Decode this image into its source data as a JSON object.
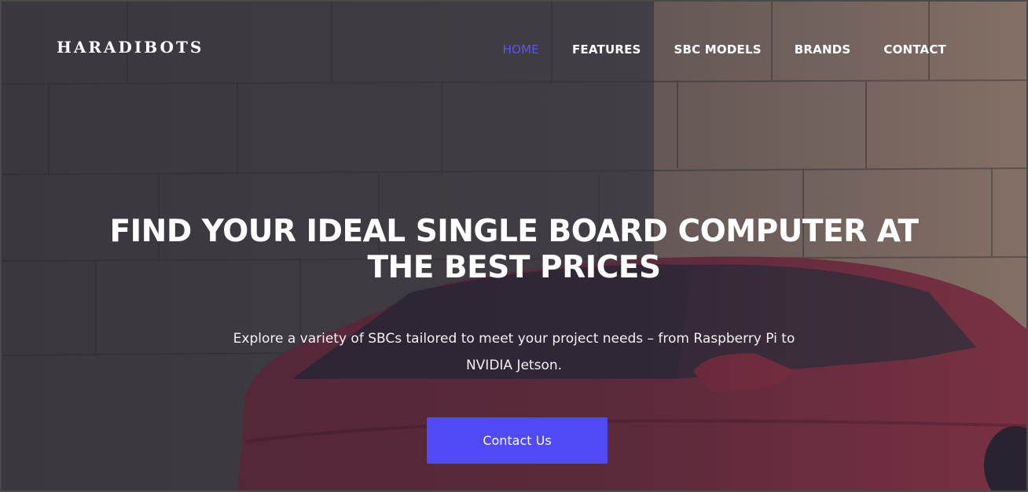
{
  "brand": {
    "logo": "HARADIBOTS"
  },
  "nav": {
    "items": [
      {
        "label": "HOME",
        "active": true
      },
      {
        "label": "FEATURES",
        "active": false
      },
      {
        "label": "SBC MODELS",
        "active": false
      },
      {
        "label": "BRANDS",
        "active": false
      },
      {
        "label": "CONTACT",
        "active": false
      }
    ]
  },
  "hero": {
    "title": "FIND YOUR IDEAL SINGLE BOARD COMPUTER AT THE BEST PRICES",
    "subtitle": "Explore a variety of SBCs tailored to meet your project needs – from Raspberry Pi to NVIDIA Jetson.",
    "cta_label": "Contact Us"
  },
  "colors": {
    "accent": "#4f4af5",
    "active_nav": "#5b54f5",
    "text": "#ffffff"
  }
}
